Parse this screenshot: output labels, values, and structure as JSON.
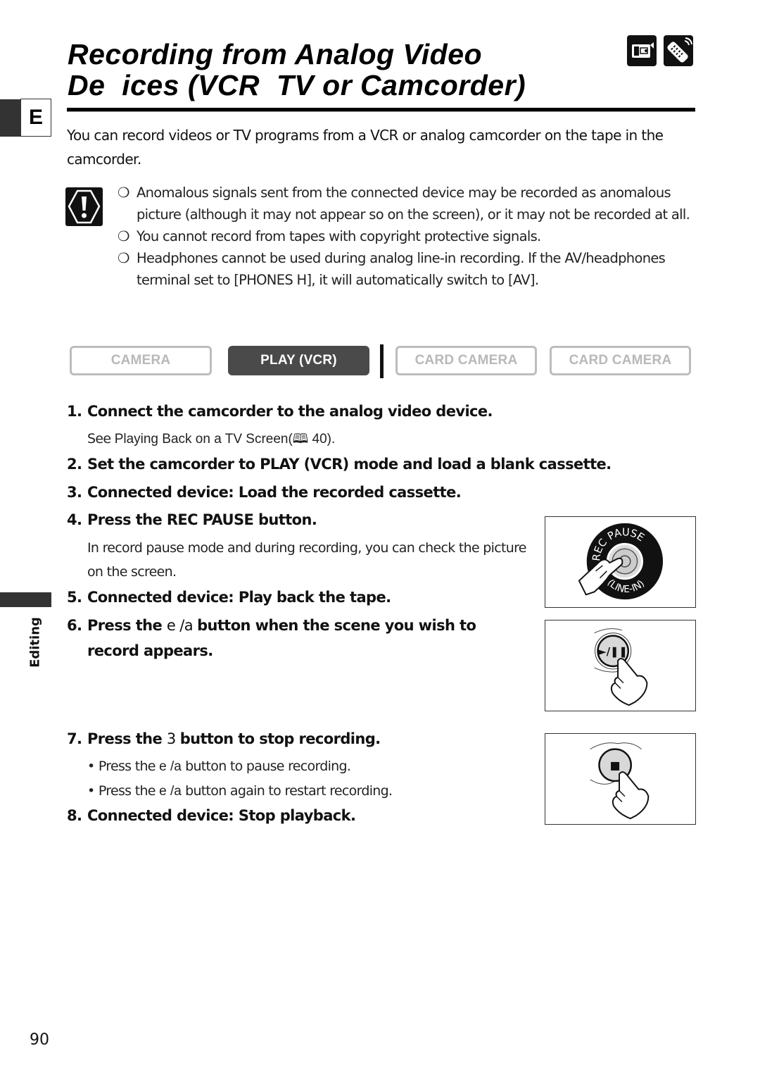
{
  "header": {
    "title_line1": "Recording from Analog Video",
    "title_line2": "De  ices (VCR  TV or Camcorder)",
    "mode_icons": [
      "camcorder-icon",
      "remote-control-icon"
    ]
  },
  "language_tab": {
    "label": "E"
  },
  "intro": "You can record videos or TV programs from a VCR or analog camcorder on the tape in the camcorder.",
  "cautions": {
    "icon": "caution-icon",
    "bullet": "❍",
    "items": [
      "Anomalous signals sent from the connected device may be recorded as anomalous picture (although it may not appear so on the screen), or it may not be recorded at all.",
      "You cannot record from tapes with copyright protective signals.",
      "Headphones cannot be used during analog line-in recording. If the AV/headphones terminal set to [PHONES H], it will automatically switch to [AV]."
    ]
  },
  "modes": [
    {
      "label": "CAMERA",
      "active": false
    },
    {
      "label": "PLAY (VCR)",
      "active": true
    },
    {
      "label": "CARD CAMERA",
      "active": false
    },
    {
      "label": "CARD CAMERA",
      "active": false
    }
  ],
  "steps": [
    {
      "num": "1.",
      "text": "Connect the camcorder to the analog video device.",
      "sub_prefix": "See ",
      "sub_ref": "Playing Back on a TV Screen",
      "sub_page": " 40)."
    },
    {
      "num": "2.",
      "text": "Set the camcorder to PLAY (VCR) mode and load a blank cassette."
    },
    {
      "num": "3.",
      "text": "Connected device: Load the recorded cassette."
    },
    {
      "num": "4.",
      "text": "Press the REC PAUSE button.",
      "sub": "In record pause mode and during recording, you can check the picture on the screen."
    },
    {
      "num": "5.",
      "text": "Connected device: Play back the tape."
    },
    {
      "num": "6.",
      "text_pre": "Press the ",
      "symbol": "e /a ",
      "text_post": " button when the scene you wish to",
      "text_line2": "record appears."
    },
    {
      "num": "7.",
      "text_pre": "Press the ",
      "symbol": "3 ",
      "text_post": " button to stop recording.",
      "bullets": [
        {
          "pre": "Press the ",
          "symbol": "e /a ",
          "post": " button to pause recording."
        },
        {
          "pre": "Press the ",
          "symbol": "e /a ",
          "post": " button again to restart recording."
        }
      ]
    },
    {
      "num": "8.",
      "text": "Connected device: Stop playback."
    }
  ],
  "figures": [
    {
      "name": "rec-pause-button",
      "ring_top": "REC PAUSE",
      "ring_bottom": "(LINE-IN)"
    },
    {
      "name": "play-pause-button",
      "label": "►/❚❚"
    },
    {
      "name": "stop-button",
      "label": "■"
    }
  ],
  "side_tab": {
    "label": "Editing"
  },
  "page_number": "90"
}
